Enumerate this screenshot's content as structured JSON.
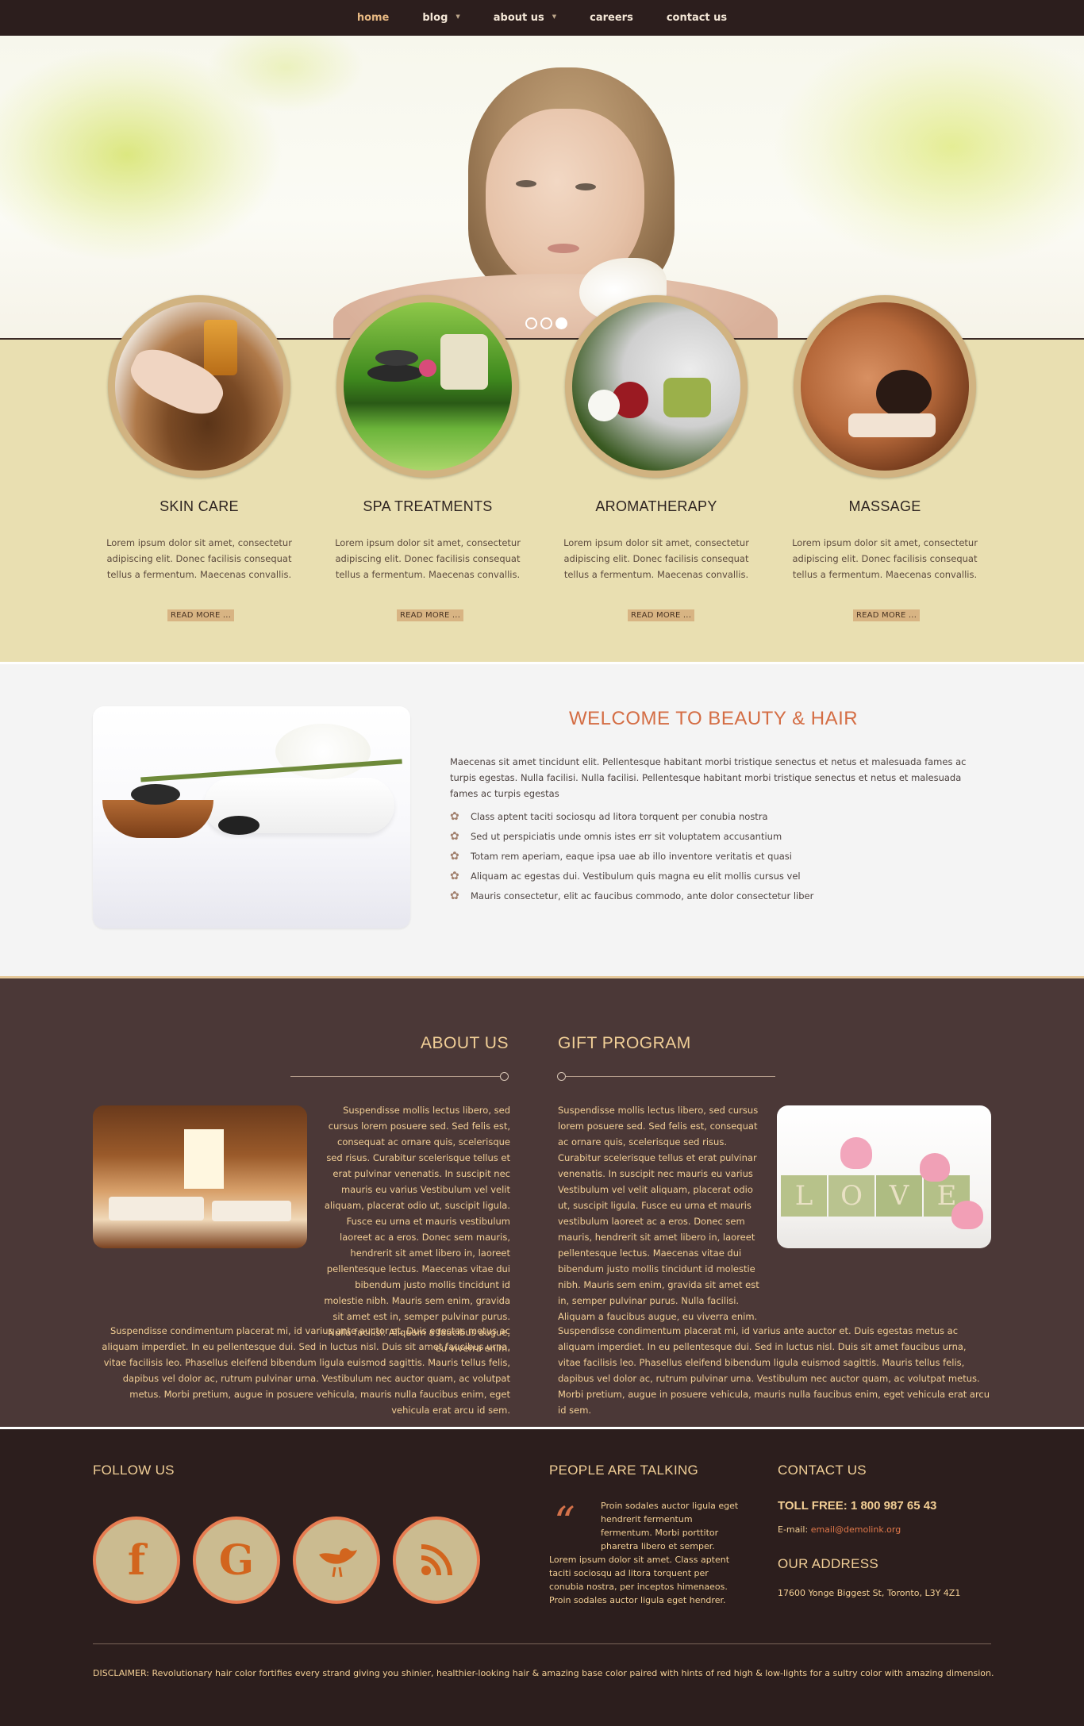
{
  "nav": {
    "items": [
      {
        "label": "home",
        "active": true,
        "dropdown": false
      },
      {
        "label": "blog",
        "active": false,
        "dropdown": true
      },
      {
        "label": "about us",
        "active": false,
        "dropdown": true
      },
      {
        "label": "careers",
        "active": false,
        "dropdown": false
      },
      {
        "label": "contact us",
        "active": false,
        "dropdown": false
      }
    ],
    "active_color": "#e7b882"
  },
  "hero": {
    "slides": 3,
    "active_slide": 3
  },
  "services": [
    {
      "title": "SKIN CARE",
      "text": "Lorem ipsum dolor sit amet, consectetur adipiscing elit. Donec facilisis consequat tellus a fermentum. Maecenas convallis.",
      "button": "READ MORE ..."
    },
    {
      "title": "SPA TREATMENTS",
      "text": "Lorem ipsum dolor sit amet, consectetur adipiscing elit. Donec facilisis consequat tellus a fermentum. Maecenas convallis.",
      "button": "READ MORE ..."
    },
    {
      "title": "AROMATHERAPY",
      "text": "Lorem ipsum dolor sit amet, consectetur adipiscing elit. Donec facilisis consequat tellus a fermentum. Maecenas convallis.",
      "button": "READ MORE ..."
    },
    {
      "title": "MASSAGE",
      "text": "Lorem ipsum dolor sit amet, consectetur adipiscing elit. Donec facilisis consequat tellus a fermentum. Maecenas convallis.",
      "button": "READ MORE ..."
    }
  ],
  "welcome": {
    "title": "WELCOME TO BEAUTY & HAIR",
    "intro": "Maecenas sit amet tincidunt elit. Pellentesque habitant morbi tristique senectus et netus et malesuada fames ac turpis egestas. Nulla facilisi. Nulla facilisi. Pellentesque habitant morbi tristique senectus et netus et malesuada fames ac turpis egestas",
    "list": [
      "Class aptent taciti sociosqu ad litora torquent per conubia nostra",
      "Sed ut perspiciatis unde omnis istes err sit voluptatem accusantium",
      "Totam rem aperiam, eaque ipsa uae ab illo inventore veritatis et quasi",
      "Aliquam ac egestas dui. Vestibulum quis magna eu elit mollis cursus vel",
      "Mauris consectetur, elit ac faucibus commodo, ante dolor consectetur liber"
    ]
  },
  "about": {
    "title": "ABOUT US",
    "text1": "Suspendisse mollis lectus libero, sed cursus lorem posuere sed. Sed felis est, consequat ac ornare quis, scelerisque sed risus. Curabitur scelerisque tellus et erat pulvinar venenatis. In suscipit nec mauris eu varius Vestibulum vel velit aliquam, placerat odio ut, suscipit ligula. Fusce eu urna et mauris vestibulum laoreet ac a eros. Donec sem mauris, hendrerit sit amet libero in, laoreet pellentesque lectus. Maecenas vitae dui bibendum justo mollis tincidunt id molestie nibh. Mauris sem enim, gravida sit amet est in, semper pulvinar purus. Nulla facilisi. Aliquam a faucibus augue, eu viverra enim.",
    "text2": "Suspendisse condimentum placerat mi, id varius ante auctor et. Duis egestas metus ac aliquam imperdiet. In eu pellentesque dui. Sed in luctus nisl. Duis sit amet faucibus urna, vitae facilisis leo. Phasellus eleifend bibendum ligula euismod sagittis. Mauris tellus felis, dapibus vel dolor ac, rutrum pulvinar urna. Vestibulum nec auctor quam, ac volutpat metus. Morbi pretium, augue in posuere vehicula, mauris nulla faucibus enim, eget vehicula erat arcu id sem."
  },
  "gift": {
    "title": "GIFT PROGRAM",
    "text1": "Suspendisse mollis lectus libero, sed cursus lorem posuere sed. Sed felis est, consequat ac ornare quis, scelerisque sed risus. Curabitur scelerisque tellus et erat pulvinar venenatis. In suscipit nec mauris eu varius Vestibulum vel velit aliquam, placerat odio ut, suscipit ligula. Fusce eu urna et mauris vestibulum laoreet ac a eros. Donec sem mauris, hendrerit sit amet libero in, laoreet pellentesque lectus. Maecenas vitae dui bibendum justo mollis tincidunt id molestie nibh. Mauris sem enim, gravida sit amet est in, semper pulvinar purus. Nulla facilisi. Aliquam a faucibus augue, eu viverra enim.",
    "text2": "Suspendisse condimentum placerat mi, id varius ante auctor et. Duis egestas metus ac aliquam imperdiet. In eu pellentesque dui. Sed in luctus nisl. Duis sit amet faucibus urna, vitae facilisis leo. Phasellus eleifend bibendum ligula euismod sagittis. Mauris tellus felis, dapibus vel dolor ac, rutrum pulvinar urna. Vestibulum nec auctor quam, ac volutpat metus. Morbi pretium, augue in posuere vehicula, mauris nulla faucibus enim, eget vehicula erat arcu id sem.",
    "love_letters": [
      "L",
      "O",
      "V",
      "E"
    ]
  },
  "footer": {
    "follow_title": "FOLLOW US",
    "social": [
      {
        "icon": "facebook-icon",
        "glyph": "f"
      },
      {
        "icon": "google-icon",
        "glyph": "G"
      },
      {
        "icon": "twitter-bird-icon",
        "glyph": ""
      },
      {
        "icon": "rss-icon",
        "glyph": ""
      }
    ],
    "talking_title": "PEOPLE ARE TALKING",
    "quote_mark": "“",
    "quote_text": "Proin sodales auctor ligula eget hendrerit fermentum fermentum. Morbi porttitor pharetra libero et semper.",
    "quote_text2": "Lorem ipsum dolor sit amet. Class aptent taciti sociosqu ad litora torquent per conubia nostra, per inceptos himenaeos. Proin sodales auctor ligula eget hendrer.",
    "contact_title": "CONTACT US",
    "toll_free": "TOLL FREE: 1 800 987 65 43",
    "email_label": "E-mail:",
    "email": "email@demolink.org",
    "address_title": "OUR ADDRESS",
    "address": "17600 Yonge Biggest St, Toronto, L3Y 4Z1",
    "disclaimer": "DISCLAIMER: Revolutionary  hair color fortifies every strand giving you shinier, healthier-looking hair & amazing base color paired with hints of red high & low-lights for a sultry color with amazing dimension."
  }
}
